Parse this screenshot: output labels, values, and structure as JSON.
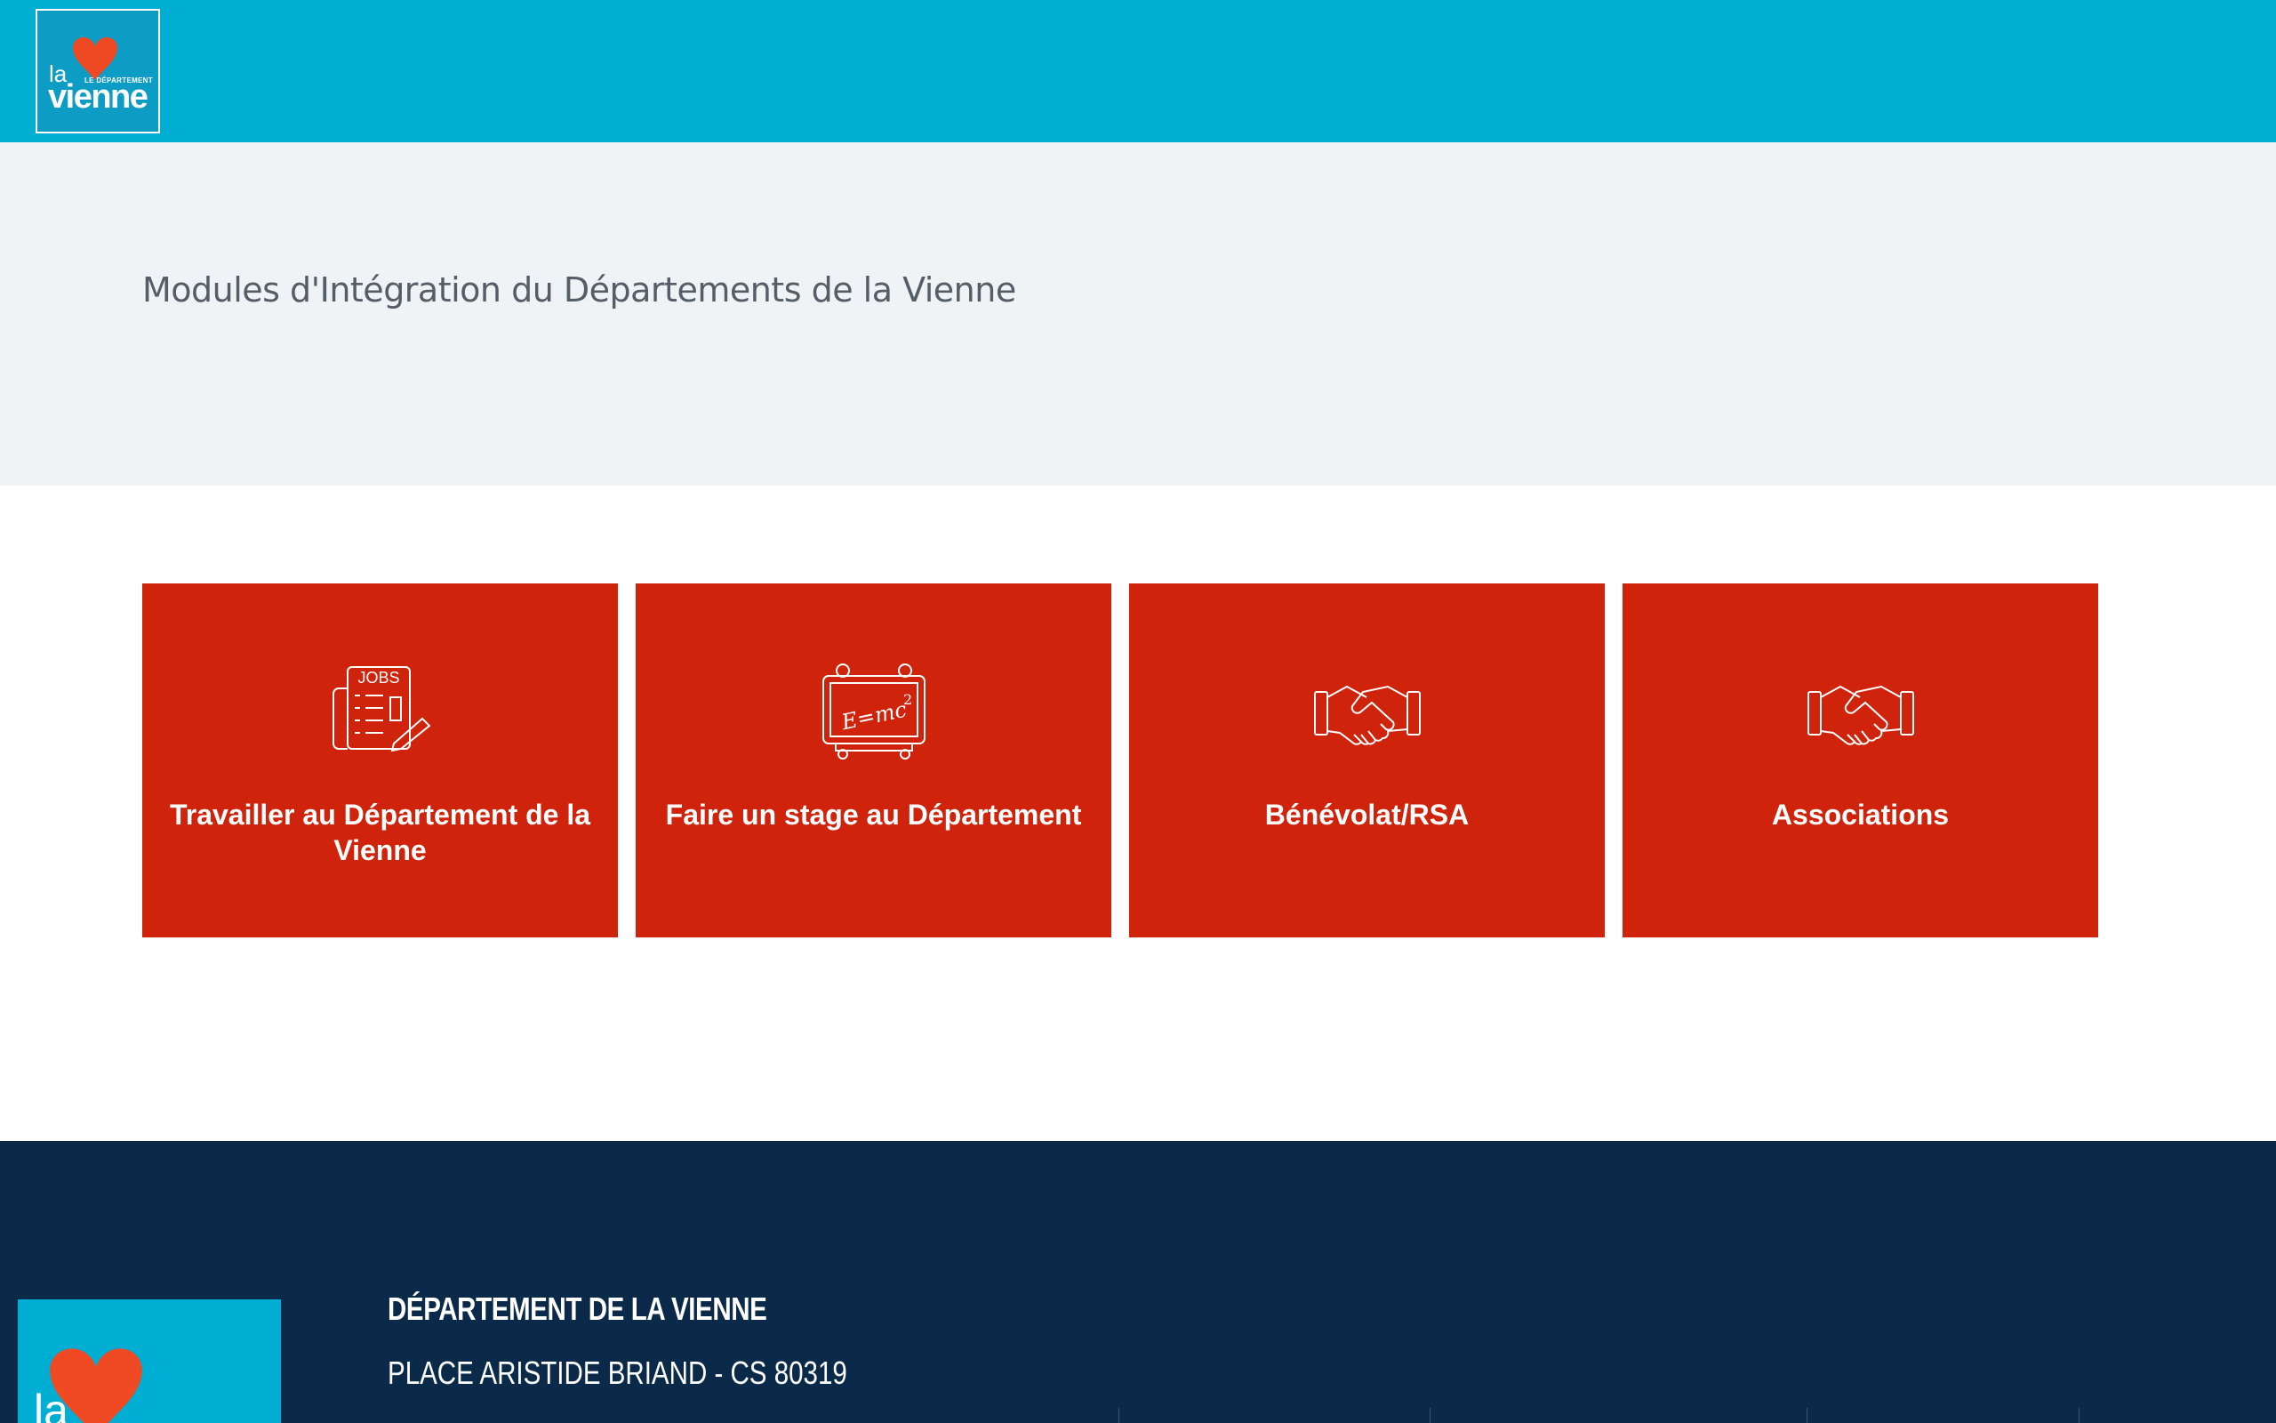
{
  "header": {
    "logo": {
      "la": "la",
      "le_departement": "LE DÉPARTEMENT",
      "vienne": "vienne"
    }
  },
  "hero": {
    "title": "Modules d'Intégration du Départements de la Vienne"
  },
  "tiles": [
    {
      "label": "Travailler au Département de la Vienne",
      "icon": "jobs-newspaper-icon"
    },
    {
      "label": "Faire un stage au Département",
      "icon": "chalkboard-emc2-icon"
    },
    {
      "label": "Bénévolat/RSA",
      "icon": "handshake-icon"
    },
    {
      "label": "Associations",
      "icon": "handshake-icon"
    }
  ],
  "icon_text": {
    "jobs": "JOBS",
    "emc2": "E=mc"
  },
  "footer": {
    "org_name": "DÉPARTEMENT DE LA VIENNE",
    "address": "PLACE ARISTIDE BRIAND - CS 80319",
    "logo_la": "la"
  },
  "colors": {
    "header_bg": "#00aed3",
    "hero_bg": "#eff3f6",
    "tile_bg": "#cf230c",
    "footer_bg": "#0b2948",
    "heart": "#ef4a23"
  }
}
